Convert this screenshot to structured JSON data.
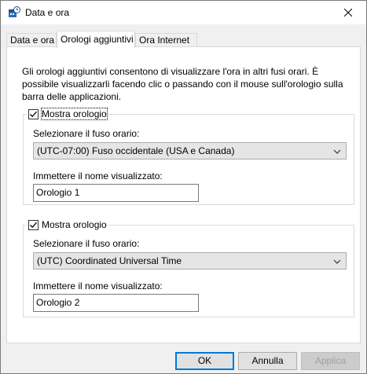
{
  "window": {
    "title": "Data e ora",
    "accent": "#0078d7"
  },
  "tabs": [
    {
      "label": "Data e ora",
      "active": false
    },
    {
      "label": "Orologi aggiuntivi",
      "active": true
    },
    {
      "label": "Ora Internet",
      "active": false
    }
  ],
  "description": "Gli orologi aggiuntivi consentono di visualizzare l'ora in altri fusi orari. È possibile visualizzarli facendo clic o passando con il mouse sull'orologio sulla barra delle applicazioni.",
  "clocks": [
    {
      "show_label": "Mostra orologio",
      "checked": true,
      "timezone_label": "Selezionare il fuso orario:",
      "timezone_value": "(UTC-07:00) Fuso occidentale (USA e Canada)",
      "name_label": "Immettere il nome visualizzato:",
      "name_value": "Orologio 1"
    },
    {
      "show_label": "Mostra orologio",
      "checked": true,
      "timezone_label": "Selezionare il fuso orario:",
      "timezone_value": "(UTC) Coordinated Universal Time",
      "name_label": "Immettere il nome visualizzato:",
      "name_value": "Orologio 2"
    }
  ],
  "buttons": {
    "ok": "OK",
    "cancel": "Annulla",
    "apply": "Applica"
  }
}
